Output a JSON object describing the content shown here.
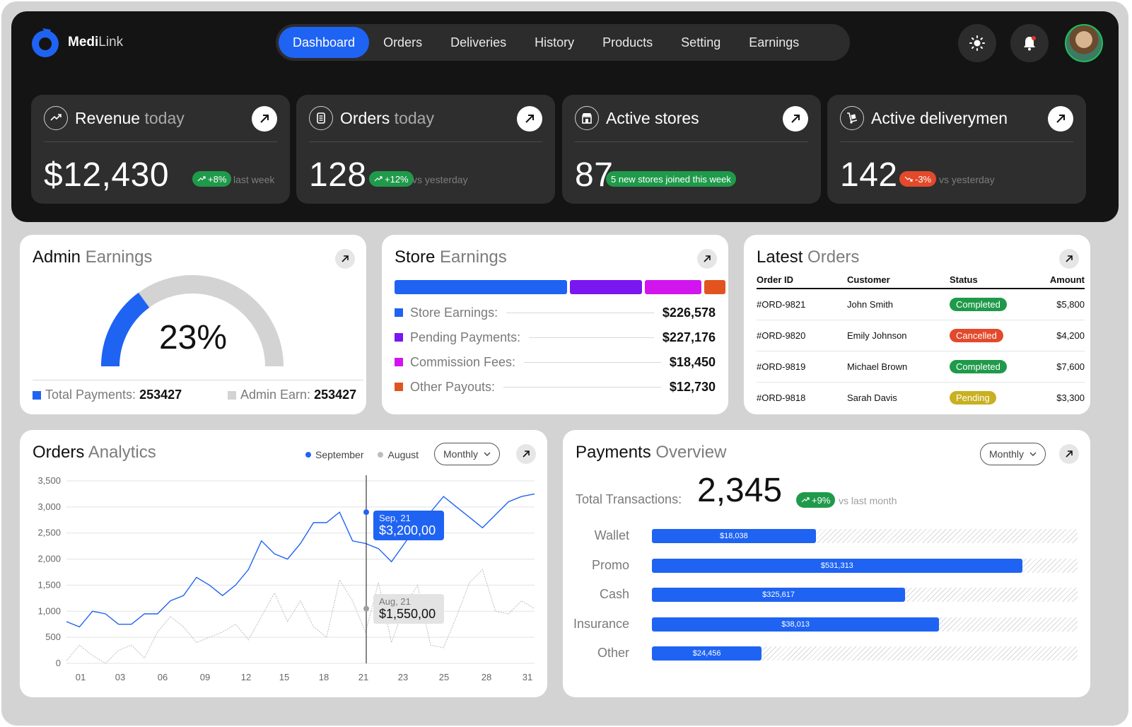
{
  "app": {
    "name_bold": "Medi",
    "name_light": "Link"
  },
  "nav": {
    "items": [
      "Dashboard",
      "Orders",
      "Deliveries",
      "History",
      "Products",
      "Setting",
      "Earnings"
    ],
    "active": "Dashboard"
  },
  "kpis": [
    {
      "title": "Revenue",
      "title_muted": " today",
      "value": "$12,430",
      "badge": "+8%",
      "badge_color": "#1f9a4a",
      "note": "last week",
      "icon": "trend-up-icon"
    },
    {
      "title": "Orders",
      "title_muted": " today",
      "value": "128",
      "badge": "+12%",
      "badge_color": "#1f9a4a",
      "note": "vs yesterday",
      "icon": "receipt-icon"
    },
    {
      "title": "Active stores",
      "title_muted": "",
      "value": "87",
      "badge": "5 new stores joined this week",
      "badge_color": "#1f9a4a",
      "note": "",
      "icon": "store-icon"
    },
    {
      "title": "Active deliverymen",
      "title_muted": "",
      "value": "142",
      "badge": "-3%",
      "badge_color": "#e3492b",
      "note": "vs yesterday",
      "icon": "dolly-icon"
    }
  ],
  "admin_earnings": {
    "title": "Admin",
    "title_muted": " Earnings",
    "percent": "23%",
    "percent_value": 23,
    "total_label": "Total Payments:",
    "total_value": "253427",
    "admin_label": "Admin Earn:",
    "admin_value": "253427",
    "colors": {
      "primary": "#1f63f3",
      "track": "#d3d3d3"
    }
  },
  "store_earnings": {
    "title": "Store",
    "title_muted": " Earnings",
    "rows": [
      {
        "label": "Store Earnings:",
        "value": "$226,578",
        "color": "#1f63f3",
        "share": 0.48
      },
      {
        "label": "Pending Payments:",
        "value": "$227,176",
        "color": "#7a16f0",
        "share": 0.2
      },
      {
        "label": "Commission Fees:",
        "value": "$18,450",
        "color": "#d214ef",
        "share": 0.16
      },
      {
        "label": "Other Payouts:",
        "value": "$12,730",
        "color": "#e2531f",
        "share": 0.06
      }
    ]
  },
  "latest_orders": {
    "title": "Latest",
    "title_muted": " Orders",
    "headers": [
      "Order ID",
      "Customer",
      "Status",
      "Amount"
    ],
    "rows": [
      {
        "id": "#ORD-9821",
        "customer": "John Smith",
        "status": "Completed",
        "status_color": "#1f9a4a",
        "amount": "$5,800"
      },
      {
        "id": "#ORD-9820",
        "customer": "Emily Johnson",
        "status": "Cancelled",
        "status_color": "#e3492b",
        "amount": "$4,200"
      },
      {
        "id": "#ORD-9819",
        "customer": "Michael Brown",
        "status": "Completed",
        "status_color": "#1f9a4a",
        "amount": "$7,600"
      },
      {
        "id": "#ORD-9818",
        "customer": "Sarah Davis",
        "status": "Pending",
        "status_color": "#c9b020",
        "amount": "$3,300"
      }
    ]
  },
  "orders_analytics": {
    "title": "Orders",
    "title_muted": " Analytics",
    "dropdown": "Monthly",
    "tooltip_sep": {
      "date": "Sep, 21",
      "value": "$3,200,00"
    },
    "tooltip_aug": {
      "date": "Aug, 21",
      "value": "$1,550,00"
    }
  },
  "payments_overview": {
    "title": "Payments",
    "title_muted": " Overview",
    "dropdown": "Monthly",
    "total_label": "Total Transactions:",
    "total_value": "2,345",
    "badge": "+9%",
    "note": "vs last month",
    "rows": [
      {
        "label": "Wallet",
        "value": "$18,038",
        "fraction": 0.385
      },
      {
        "label": "Promo",
        "value": "$531,313",
        "fraction": 0.87
      },
      {
        "label": "Cash",
        "value": "$325,617",
        "fraction": 0.595
      },
      {
        "label": "Insurance",
        "value": "$38,013",
        "fraction": 0.675
      },
      {
        "label": "Other",
        "value": "$24,456",
        "fraction": 0.258
      }
    ]
  },
  "chart_data": {
    "type": "line",
    "x": [
      "01",
      "02",
      "03",
      "04",
      "05",
      "06",
      "07",
      "08",
      "09",
      "10",
      "11",
      "12",
      "13",
      "14",
      "15",
      "16",
      "17",
      "18",
      "19",
      "20",
      "21",
      "22",
      "23",
      "24",
      "25",
      "26",
      "27",
      "28",
      "29",
      "30",
      "31"
    ],
    "x_ticks": [
      "01",
      "03",
      "06",
      "09",
      "12",
      "15",
      "18",
      "21",
      "23",
      "25",
      "28",
      "31"
    ],
    "y_ticks": [
      "0",
      "500",
      "1,000",
      "1,500",
      "2,000",
      "2,500",
      "3,000",
      "3,500"
    ],
    "ylim": [
      0,
      3500
    ],
    "series": [
      {
        "name": "September",
        "color": "#1f63f3",
        "values": [
          800,
          700,
          1000,
          950,
          750,
          750,
          950,
          950,
          1200,
          1300,
          1650,
          1500,
          1300,
          1500,
          1800,
          2350,
          2100,
          2000,
          2300,
          2700,
          2700,
          2900,
          2350,
          2300,
          2200,
          1950,
          2300,
          2650,
          2900,
          3200,
          3000,
          2800,
          2600,
          2850,
          3100,
          3200,
          3250
        ]
      },
      {
        "name": "August",
        "color": "#bdbdbd",
        "values": [
          50,
          350,
          150,
          0,
          250,
          350,
          100,
          600,
          900,
          700,
          400,
          500,
          600,
          750,
          450,
          900,
          1350,
          800,
          1200,
          700,
          500,
          1600,
          1200,
          600,
          1550,
          400,
          1100,
          1500,
          350,
          300,
          900,
          1550,
          1800,
          1000,
          950,
          1200,
          1050
        ]
      }
    ]
  }
}
